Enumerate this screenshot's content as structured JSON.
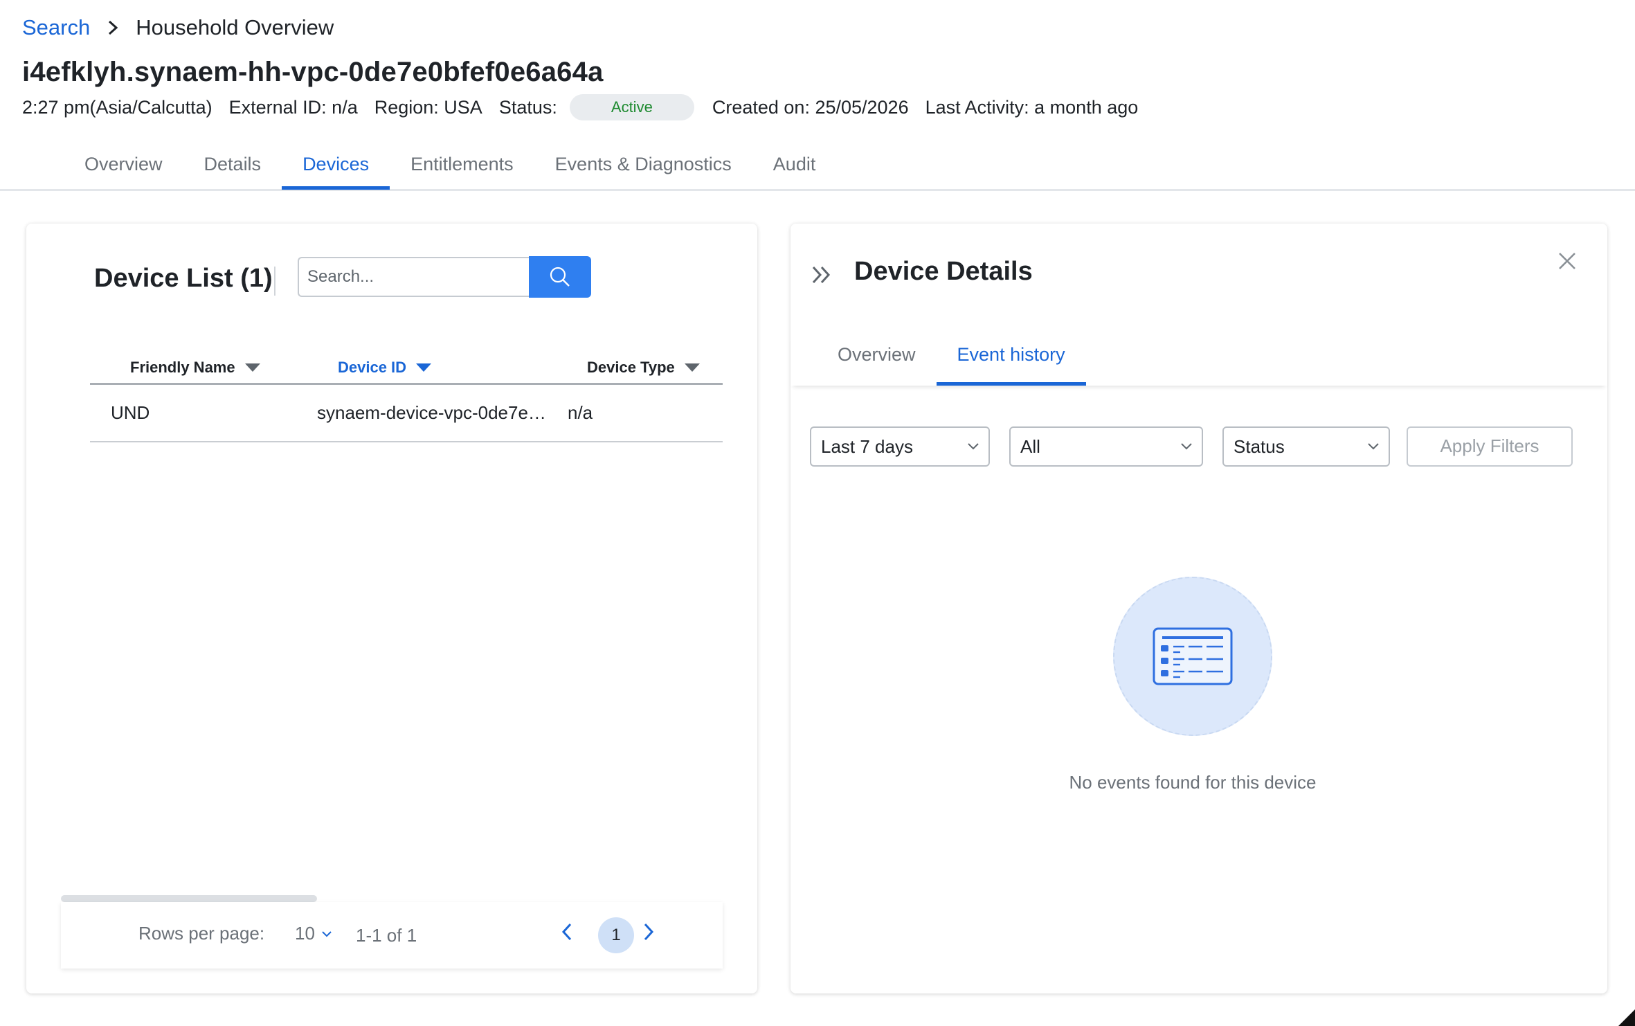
{
  "breadcrumb": {
    "root": "Search",
    "current": "Household Overview"
  },
  "household": {
    "title": "i4efklyh.synaem-hh-vpc-0de7e0bfef0e6a64a",
    "time": "2:27 pm(Asia/Calcutta)",
    "external_id": "External ID: n/a",
    "region": "Region: USA",
    "status_label": "Status:",
    "status_value": "Active",
    "created_on": "Created on: 25/05/2026",
    "last_activity": "Last Activity: a month ago"
  },
  "tabs": [
    {
      "label": "Overview"
    },
    {
      "label": "Details"
    },
    {
      "label": "Devices",
      "active": true
    },
    {
      "label": "Entitlements"
    },
    {
      "label": "Events & Diagnostics"
    },
    {
      "label": "Audit"
    }
  ],
  "device_list": {
    "title": "Device List (1)",
    "search_placeholder": "Search...",
    "columns": [
      {
        "label": "Friendly Name"
      },
      {
        "label": "Device ID",
        "active": true
      },
      {
        "label": "Device Type"
      }
    ],
    "rows": [
      {
        "friendly_name": "UND",
        "device_id": "synaem-device-vpc-0de7e…",
        "device_type": "n/a"
      }
    ],
    "pagination": {
      "rows_per_page_label": "Rows per page:",
      "rows_per_page_value": "10",
      "range": "1-1 of 1",
      "current_page": "1"
    }
  },
  "device_details": {
    "title": "Device Details",
    "tabs": [
      {
        "label": "Overview"
      },
      {
        "label": "Event history",
        "active": true
      }
    ],
    "filters": {
      "time_range": "Last 7 days",
      "type": "All",
      "status": "Status",
      "apply_label": "Apply Filters"
    },
    "empty_message": "No events found for this device"
  },
  "colors": {
    "accent": "#1a66d6",
    "search_button": "#2f7ff0",
    "status_text": "#1d8a2f",
    "status_bg": "#e9ecef",
    "empty_circle": "#dce8fb"
  }
}
